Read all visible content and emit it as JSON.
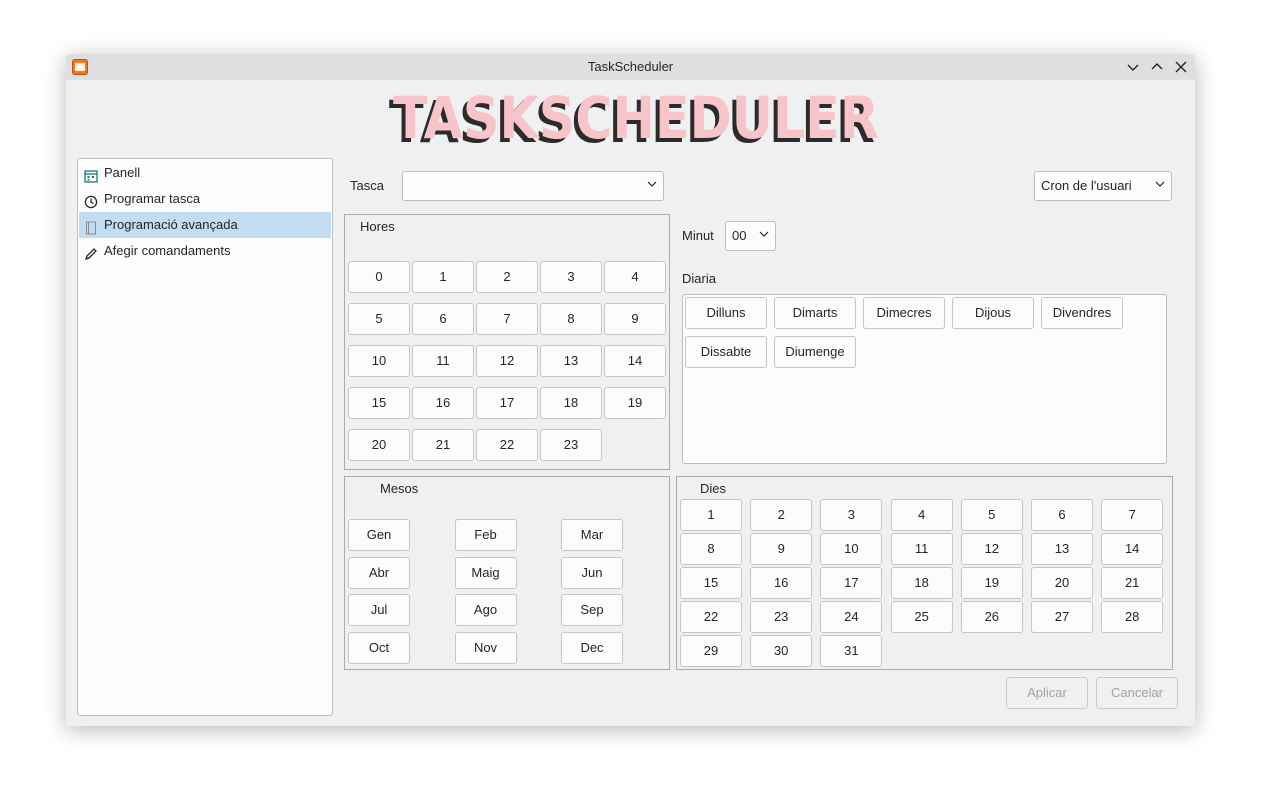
{
  "window": {
    "title": "TaskScheduler"
  },
  "logo": {
    "text": "TASKSCHEDULER"
  },
  "sidebar": {
    "items": [
      {
        "label": "Panell",
        "icon": "calendar-icon"
      },
      {
        "label": "Programar tasca",
        "icon": "clock-icon"
      },
      {
        "label": "Programació avançada",
        "icon": "document-icon"
      },
      {
        "label": "Afegir comandaments",
        "icon": "pencil-icon"
      }
    ],
    "selected": 2
  },
  "task": {
    "label": "Tasca",
    "value": ""
  },
  "cron": {
    "value": "Cron de l'usuari"
  },
  "hours": {
    "title": "Hores",
    "items": [
      "0",
      "1",
      "2",
      "3",
      "4",
      "5",
      "6",
      "7",
      "8",
      "9",
      "10",
      "11",
      "12",
      "13",
      "14",
      "15",
      "16",
      "17",
      "18",
      "19",
      "20",
      "21",
      "22",
      "23"
    ]
  },
  "minute": {
    "label": "Minut",
    "value": "00"
  },
  "daily": {
    "title": "Diaria",
    "items": [
      "Dilluns",
      "Dimarts",
      "Dimecres",
      "Dijous",
      "Divendres",
      "Dissabte",
      "Diumenge"
    ]
  },
  "months": {
    "title": "Mesos",
    "items": [
      "Gen",
      "Feb",
      "Mar",
      "Abr",
      "Maig",
      "Jun",
      "Jul",
      "Ago",
      "Sep",
      "Oct",
      "Nov",
      "Dec"
    ]
  },
  "days": {
    "title": "Dies",
    "items": [
      "1",
      "2",
      "3",
      "4",
      "5",
      "6",
      "7",
      "8",
      "9",
      "10",
      "11",
      "12",
      "13",
      "14",
      "15",
      "16",
      "17",
      "18",
      "19",
      "20",
      "21",
      "22",
      "23",
      "24",
      "25",
      "26",
      "27",
      "28",
      "29",
      "30",
      "31"
    ]
  },
  "actions": {
    "apply": "Aplicar",
    "cancel": "Cancelar"
  },
  "colors": {
    "selection": "#c2dcf2",
    "window_bg": "#eff0f1",
    "logo_pink": "#f7c4ca",
    "app_icon": "#f07a1f"
  }
}
